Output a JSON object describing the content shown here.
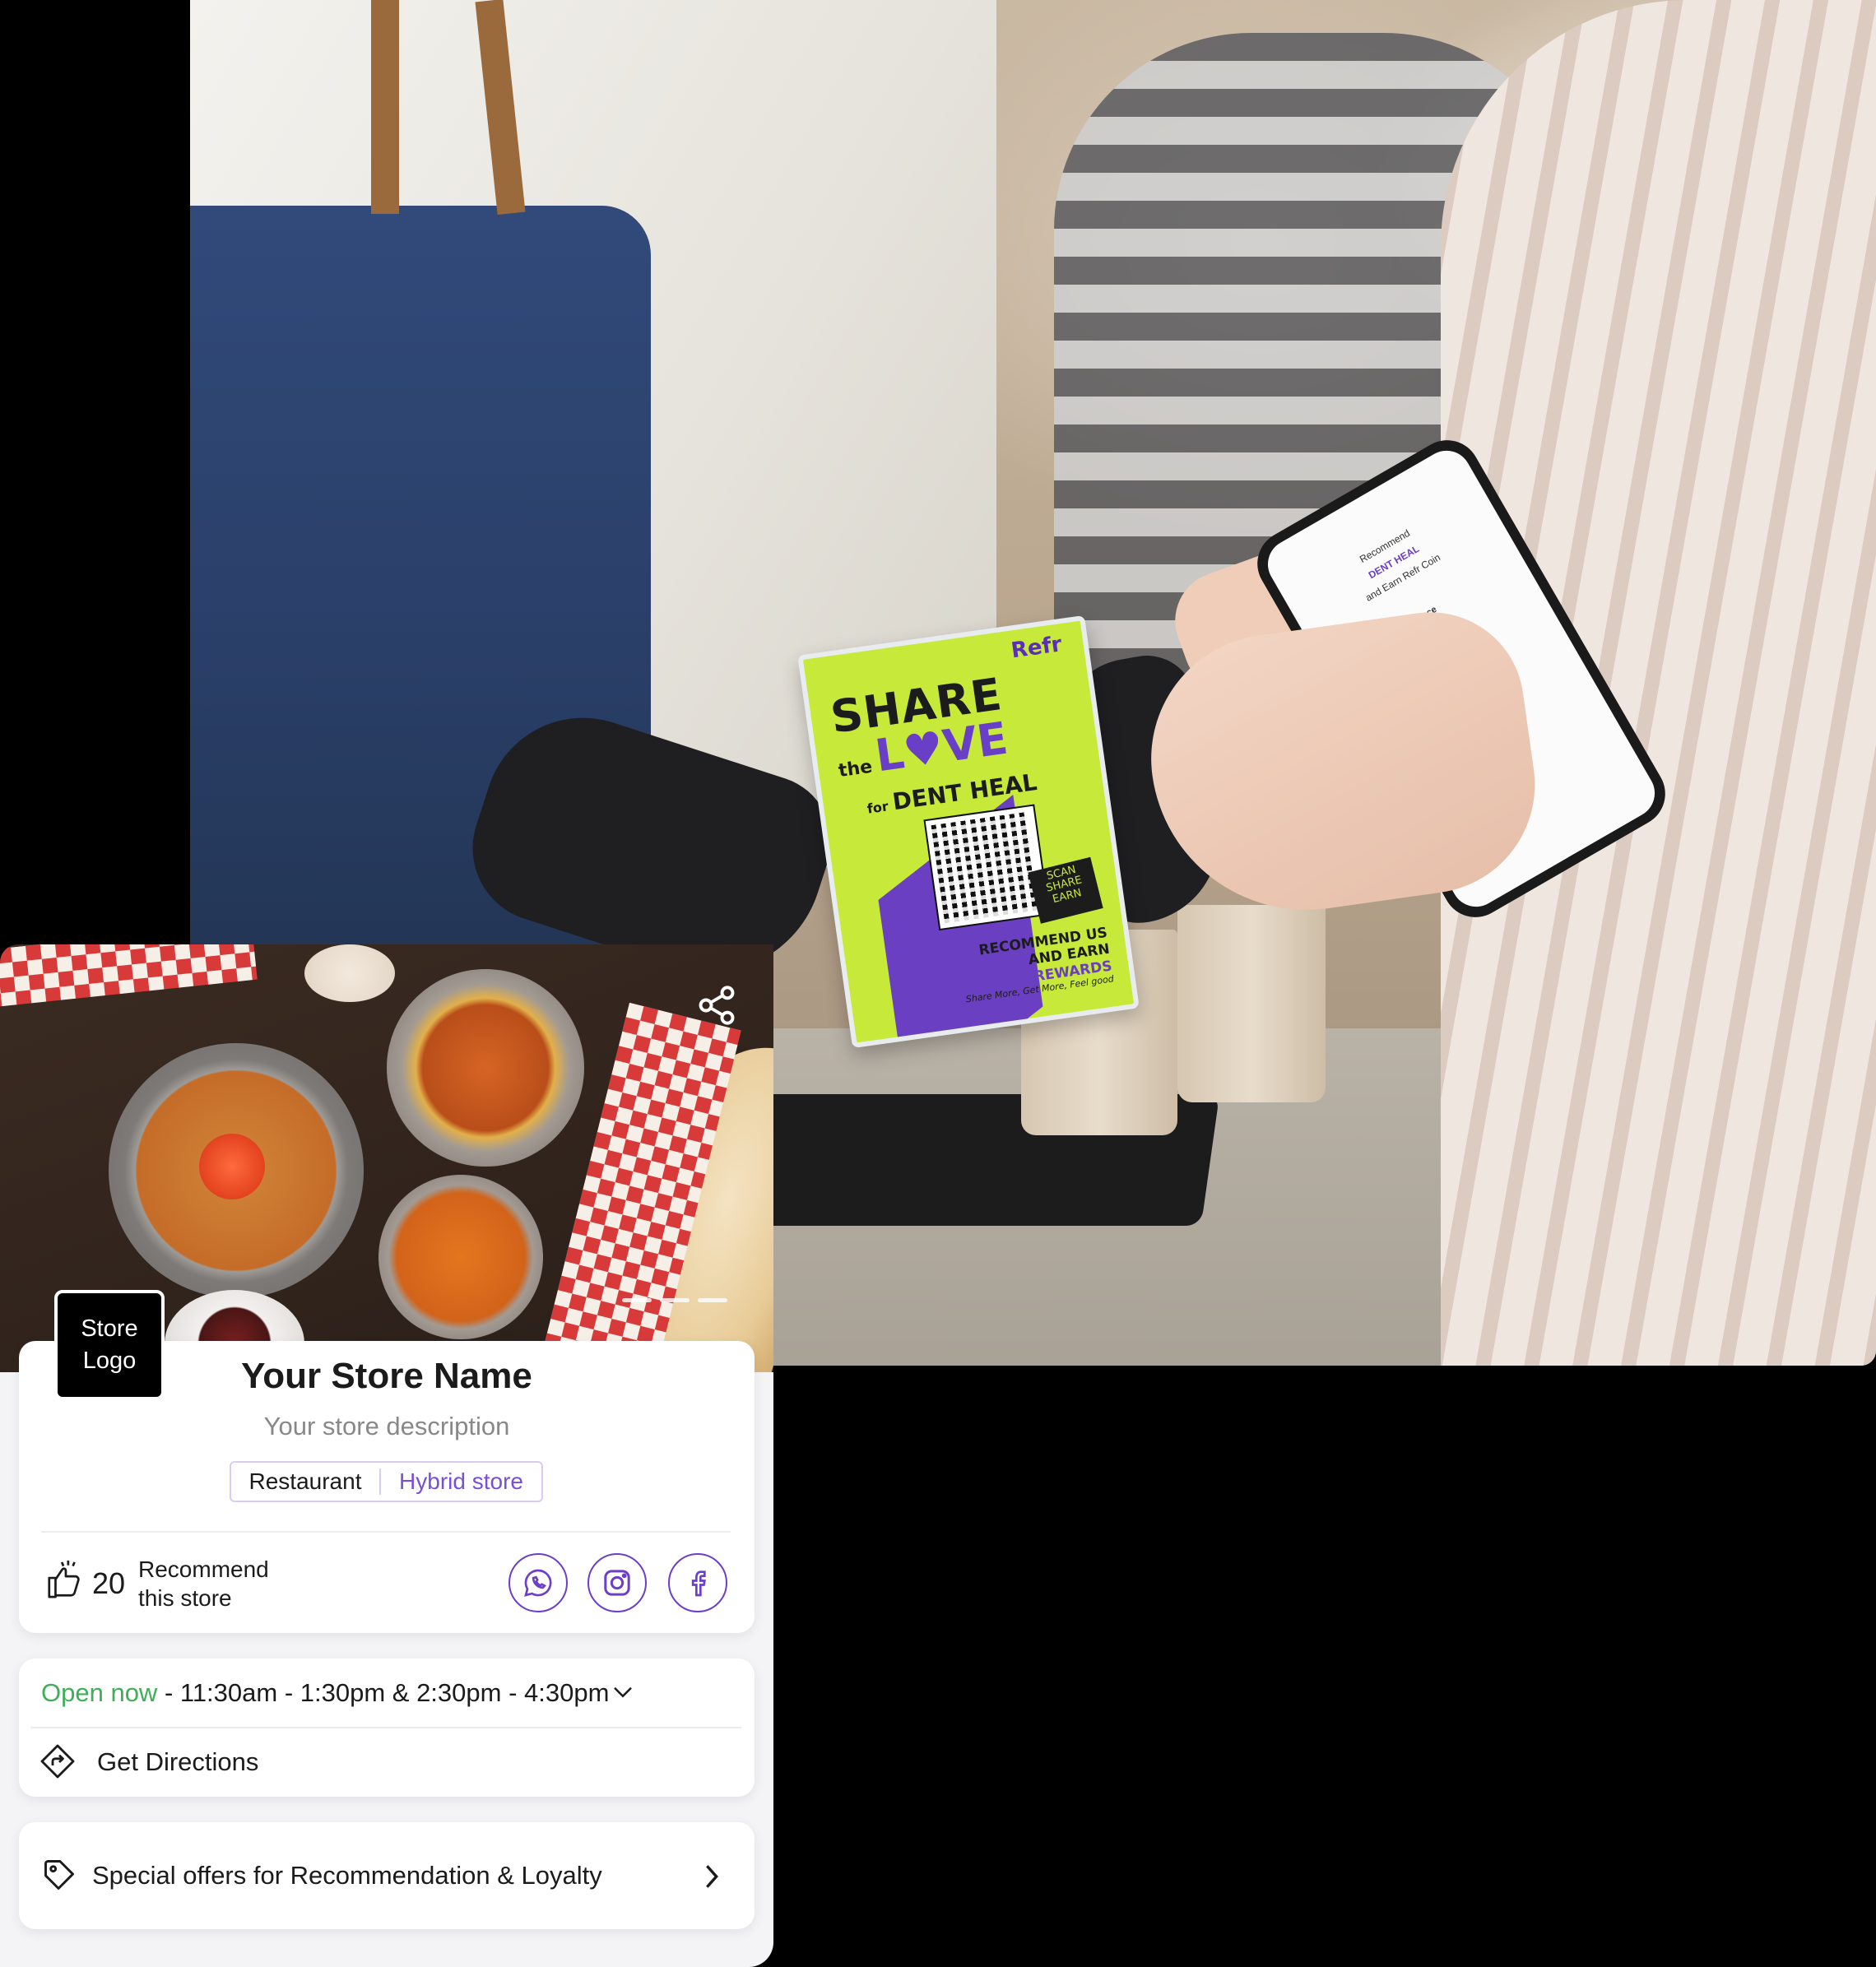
{
  "colors": {
    "accent": "#6b3fc9",
    "open_green": "#3fae57",
    "tent_green": "#c6e93a",
    "background": "#000000"
  },
  "hero": {
    "tent_card": {
      "brand": "Refr",
      "headline_line1": "SHARE",
      "headline_the": "the",
      "headline_love": "L♥VE",
      "for_small": "for",
      "for_name": "DENT HEAL",
      "badge": "SCAN SHARE EARN",
      "recommend_line": "RECOMMEND US AND EARN",
      "recommend_highlight": "REWARDS",
      "tagline": "Share More, Get More, Feel good"
    },
    "phone_screen": {
      "line1": "Recommend",
      "line2": "DENT HEAL",
      "line3": "and Earn Refr Coin",
      "line4": "Describe your experience"
    }
  },
  "store": {
    "logo_text_1": "Store",
    "logo_text_2": "Logo",
    "name": "Your Store Name",
    "description": "Your store description",
    "category_primary": "Restaurant",
    "category_secondary": "Hybrid store",
    "recommend_count": "20",
    "recommend_label_1": "Recommend",
    "recommend_label_2": "this store",
    "social": [
      "whatsapp-icon",
      "instagram-icon",
      "facebook-icon"
    ],
    "open_status": "Open now",
    "hours": " - 11:30am - 1:30pm & 2:30pm - 4:30pm",
    "directions_label": "Get Directions",
    "offers_label": "Special offers for Recommendation & Loyalty"
  }
}
